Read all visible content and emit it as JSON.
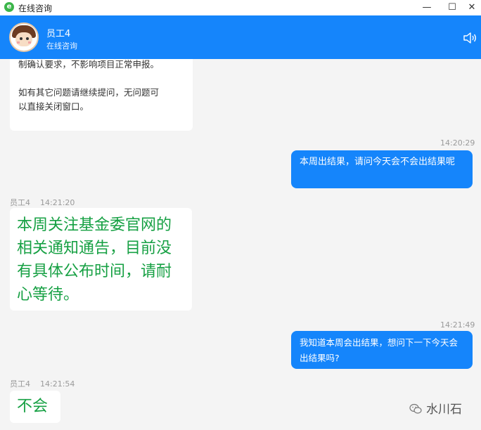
{
  "window": {
    "title": "在线咨询",
    "controls": {
      "minimize": "—",
      "maximize": "☐",
      "close": "✕"
    }
  },
  "header": {
    "name": "员工4",
    "status": "在线咨询",
    "speaker_icon": "speaker-icon",
    "bg_color": "#1585fb"
  },
  "messages": [
    {
      "side": "left",
      "lines": [
        "制确认要求，不影响项目正常申报。",
        "如有其它问题请继续提问，无问题可",
        "以直接关闭窗口。"
      ]
    },
    {
      "side": "right",
      "time": "14:20:29",
      "text": "本周出结果，请问今天会不会出结果呢"
    },
    {
      "side": "left",
      "sender": "员工4",
      "time": "14:21:20",
      "text": "本周关注基金委官网的相关通知通告，目前没有具体公布时间，请耐心等待。"
    },
    {
      "side": "right",
      "time": "14:21:49",
      "text": "我知道本周会出结果，想问下一下今天会出结果吗?"
    },
    {
      "side": "left",
      "sender": "员工4",
      "time": "14:21:54",
      "text": "不会"
    }
  ],
  "watermark": {
    "text": "水川石",
    "icon": "wechat-icon"
  },
  "colors": {
    "accent": "#1585fb",
    "highlight_text": "#16a043",
    "background": "#f4f4f4"
  }
}
